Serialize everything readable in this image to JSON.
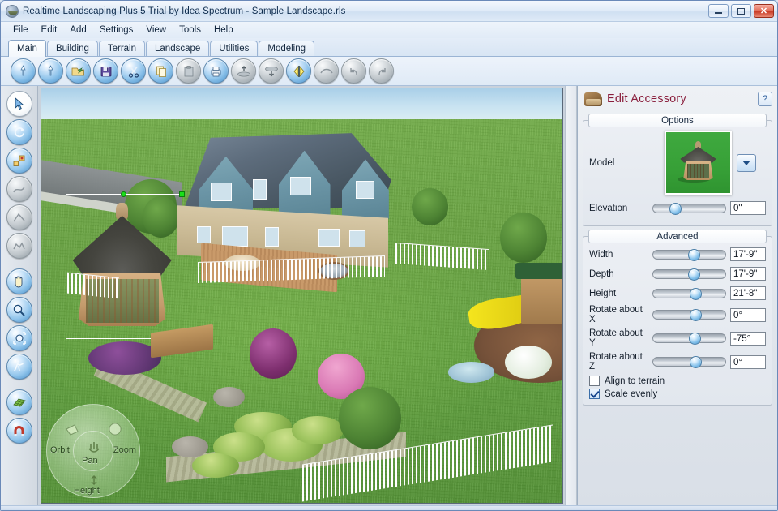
{
  "window": {
    "title": "Realtime Landscaping Plus 5 Trial by Idea Spectrum - Sample Landscape.rls",
    "app_icon": "app-globe-icon",
    "minimize_label": "Minimize",
    "maximize_label": "Maximize",
    "close_label": "✕"
  },
  "menubar": {
    "items": [
      {
        "label": "File"
      },
      {
        "label": "Edit"
      },
      {
        "label": "Add"
      },
      {
        "label": "Settings"
      },
      {
        "label": "View"
      },
      {
        "label": "Tools"
      },
      {
        "label": "Help"
      }
    ]
  },
  "tabs": {
    "items": [
      {
        "label": "Main",
        "active": true
      },
      {
        "label": "Building",
        "active": false
      },
      {
        "label": "Terrain",
        "active": false
      },
      {
        "label": "Landscape",
        "active": false
      },
      {
        "label": "Utilities",
        "active": false
      },
      {
        "label": "Modeling",
        "active": false
      }
    ]
  },
  "toolbar": {
    "buttons": [
      {
        "name": "new-document-icon",
        "enabled": true
      },
      {
        "name": "open-document-icon",
        "enabled": true
      },
      {
        "name": "open-folder-icon",
        "enabled": true
      },
      {
        "name": "save-floppy-icon",
        "enabled": true
      },
      {
        "name": "cut-scissors-icon",
        "enabled": true
      },
      {
        "name": "copy-pages-icon",
        "enabled": true
      },
      {
        "name": "paste-clipboard-icon",
        "enabled": false
      },
      {
        "name": "print-icon",
        "enabled": true
      },
      {
        "name": "raise-object-icon",
        "enabled": false
      },
      {
        "name": "lower-object-icon",
        "enabled": false
      },
      {
        "name": "mirror-flip-icon",
        "enabled": true
      },
      {
        "name": "smooth-icon",
        "enabled": false
      },
      {
        "name": "undo-arrow-icon",
        "enabled": false
      },
      {
        "name": "redo-arrow-icon",
        "enabled": false
      }
    ]
  },
  "sidebar": {
    "buttons": [
      {
        "name": "select-arrow-tool",
        "enabled": true,
        "style": "white"
      },
      {
        "name": "rotate-tool",
        "enabled": true,
        "style": "blue"
      },
      {
        "name": "copy-objects-tool",
        "enabled": true,
        "style": "blue"
      },
      {
        "name": "draw-curve-tool",
        "enabled": false,
        "style": "dim"
      },
      {
        "name": "draw-polygon-tool",
        "enabled": false,
        "style": "dim"
      },
      {
        "name": "draw-region-tool",
        "enabled": false,
        "style": "dim"
      },
      {
        "name": "pan-hand-tool",
        "enabled": true,
        "style": "blue"
      },
      {
        "name": "zoom-magnifier-tool",
        "enabled": true,
        "style": "blue"
      },
      {
        "name": "zoom-to-fit-tool",
        "enabled": true,
        "style": "blue"
      },
      {
        "name": "walk-through-tool",
        "enabled": true,
        "style": "blue"
      },
      {
        "name": "grid-snap-tool",
        "enabled": true,
        "style": "blue"
      },
      {
        "name": "magnet-snap-tool",
        "enabled": true,
        "style": "blue"
      }
    ]
  },
  "viewport": {
    "navigation": {
      "orbit_label": "Orbit",
      "pan_label": "Pan",
      "zoom_label": "Zoom",
      "height_label": "Height"
    },
    "selection": {
      "object": "gazebo",
      "handle_color": "#19e019"
    },
    "scene_colors": {
      "sky": "#bcdceb",
      "grass": "#6ba544",
      "roof": "#4c5a66",
      "siding": "#6b95a6",
      "slide": "#f2e013",
      "mulch": "#76523a"
    }
  },
  "panel": {
    "icon": "gazebo-accessory-icon",
    "title": "Edit Accessory",
    "help_label": "?",
    "options": {
      "caption": "Options",
      "model_label": "Model",
      "model_dropdown_icon": "chevron-down-icon",
      "elevation_label": "Elevation",
      "elevation_value": "0\"",
      "elevation_knob_pct": 22
    },
    "advanced": {
      "caption": "Advanced",
      "rows": [
        {
          "label": "Width",
          "value": "17'-9\"",
          "knob_pct": 48
        },
        {
          "label": "Depth",
          "value": "17'-9\"",
          "knob_pct": 48
        },
        {
          "label": "Height",
          "value": "21'-8\"",
          "knob_pct": 50
        },
        {
          "label": "Rotate about X",
          "value": "0°",
          "knob_pct": 50
        },
        {
          "label": "Rotate about Y",
          "value": "-75°",
          "knob_pct": 49
        },
        {
          "label": "Rotate about Z",
          "value": "0°",
          "knob_pct": 50
        }
      ],
      "checkboxes": [
        {
          "label": "Align to terrain",
          "checked": false
        },
        {
          "label": "Scale evenly",
          "checked": true
        }
      ]
    }
  }
}
